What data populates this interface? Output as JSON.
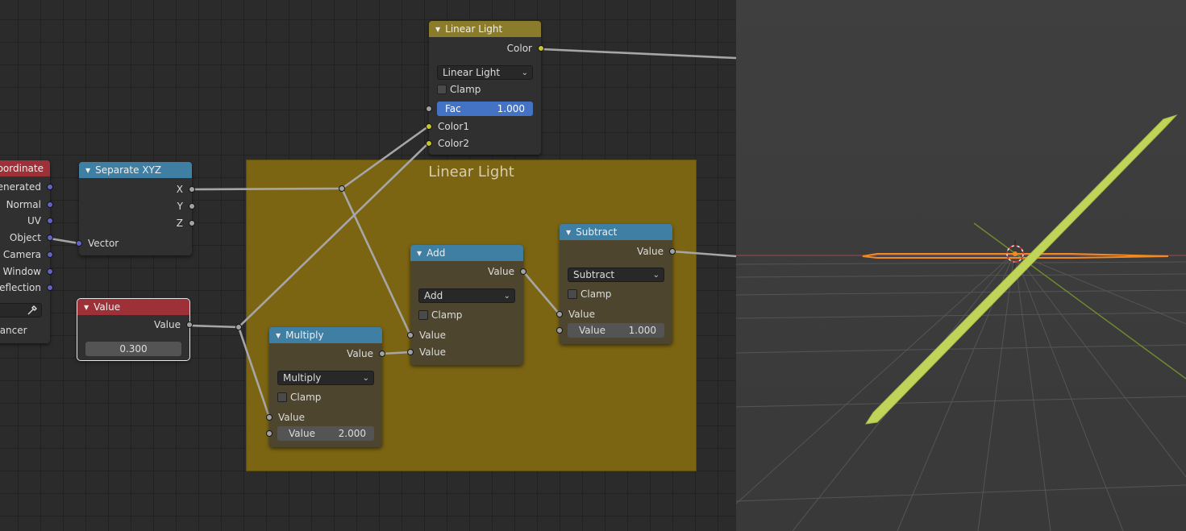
{
  "frame": {
    "title": "Linear Light"
  },
  "nodes": {
    "texcoord": {
      "title": "oordinate",
      "outputs": [
        "enerated",
        "Normal",
        "UV",
        "Object",
        "Camera",
        "Window",
        "Reflection"
      ],
      "instancer_label": "tancer"
    },
    "separate_xyz": {
      "title": "Separate XYZ",
      "outputs": [
        "X",
        "Y",
        "Z"
      ],
      "input": "Vector"
    },
    "value": {
      "title": "Value",
      "output": "Value",
      "field_value": "0.300"
    },
    "linear_light": {
      "title": "Linear Light",
      "output": "Color",
      "blend_mode": "Linear Light",
      "clamp_label": "Clamp",
      "fac_label": "Fac",
      "fac_value": "1.000",
      "inputs": [
        "Color1",
        "Color2"
      ]
    },
    "multiply": {
      "title": "Multiply",
      "output": "Value",
      "operation": "Multiply",
      "clamp_label": "Clamp",
      "input1": "Value",
      "input2_label": "Value",
      "input2_value": "2.000"
    },
    "add": {
      "title": "Add",
      "output": "Value",
      "operation": "Add",
      "clamp_label": "Clamp",
      "input1": "Value",
      "input2": "Value"
    },
    "subtract": {
      "title": "Subtract",
      "output": "Value",
      "operation": "Subtract",
      "clamp_label": "Clamp",
      "input1": "Value",
      "input2_label": "Value",
      "input2_value": "1.000"
    }
  },
  "colors": {
    "math_header": "#3f7fa3",
    "input_header": "#9e3038",
    "mix_header": "#8b7c2c",
    "frame": "#7b6513",
    "float_socket": "#a1a1a1",
    "color_socket": "#c7c729",
    "vector_socket": "#6363c7",
    "fac_field": "#4472c4",
    "plane_object": "#c1d45a",
    "selected_outline": "#f08a24"
  }
}
